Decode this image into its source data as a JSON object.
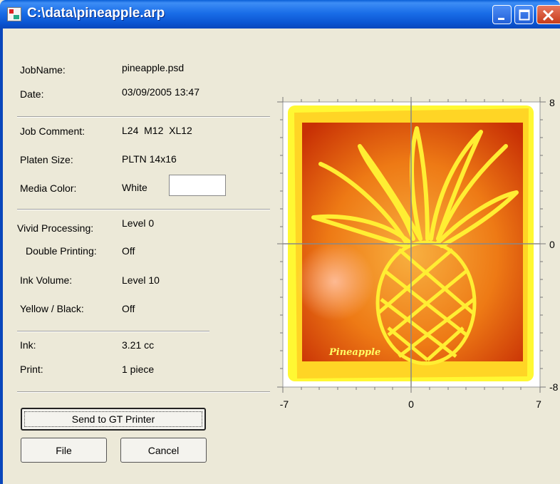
{
  "window": {
    "title": "C:\\data\\pineapple.arp"
  },
  "fields": {
    "job_name": {
      "label": "JobName:",
      "value": "pineapple.psd"
    },
    "date": {
      "label": "Date:",
      "value": "03/09/2005 13:47"
    },
    "job_comment": {
      "label": "Job Comment:",
      "value": "L24  M12  XL12"
    },
    "platen_size": {
      "label": "Platen Size:",
      "value": "PLTN 14x16"
    },
    "media_color": {
      "label": "Media Color:",
      "value": "White",
      "swatch_color": "#ffffff"
    },
    "vivid_processing": {
      "label": "Vivid Processing:",
      "value": "Level 0"
    },
    "double_printing": {
      "label": "Double Printing:",
      "value": "Off"
    },
    "ink_volume": {
      "label": "Ink Volume:",
      "value": "Level 10"
    },
    "yellow_black": {
      "label": "Yellow / Black:",
      "value": "Off"
    },
    "ink": {
      "label": "Ink:",
      "value": "3.21 cc"
    },
    "print": {
      "label": "Print:",
      "value": "1 piece"
    }
  },
  "buttons": {
    "send": "Send to GT Printer",
    "file": "File",
    "cancel": "Cancel"
  },
  "preview": {
    "x_axis_labels": [
      "-7",
      "0",
      "7"
    ],
    "y_axis_labels": [
      "8",
      "0",
      "-8"
    ],
    "image_caption": "Pineapple",
    "colors": {
      "frame": "#ffff33",
      "background_outer": "#d23a05",
      "background_inner": "#f5a030",
      "line": "#ffee33"
    }
  }
}
